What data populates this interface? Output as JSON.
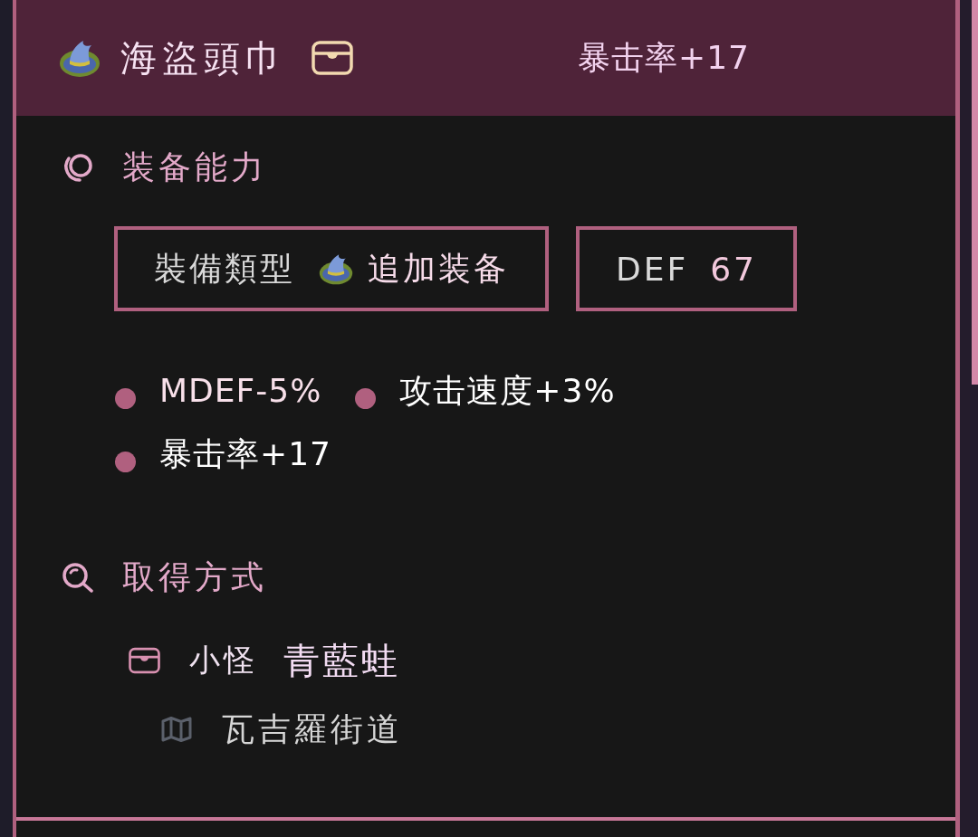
{
  "item": {
    "name": "海盜頭巾",
    "stat": "暴击率+17"
  },
  "sections": [
    {
      "kind": "abilities",
      "title": "装备能力",
      "badges": [
        {
          "kind": "type",
          "label": "裝備類型",
          "value": "追加装备"
        },
        {
          "kind": "stat",
          "label": "DEF",
          "value": "67"
        }
      ],
      "effects": [
        {
          "text": "MDEF-5%",
          "color": "#f8e0ea"
        },
        {
          "text": "攻击速度+3%",
          "color": "#ffffff"
        },
        {
          "text": "暴击率+17",
          "color": "#ffffff"
        }
      ]
    },
    {
      "kind": "sources",
      "title": "取得方式",
      "sources": [
        {
          "type": "小怪",
          "name": "青藍蛙",
          "location": "瓦吉羅街道"
        }
      ]
    }
  ]
}
